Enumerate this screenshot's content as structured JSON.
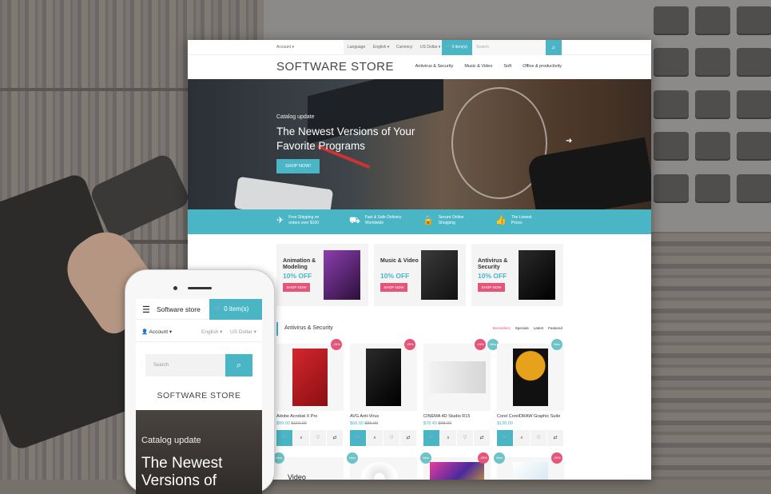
{
  "desktop": {
    "topbar": {
      "account": "Account ▾",
      "language": "Language",
      "language_value": "English ▾",
      "currency": "Currency",
      "currency_value": "US Dollar ▾",
      "cart": "0 item(s)",
      "search_placeholder": "Search"
    },
    "logo": "SOFTWARE STORE",
    "nav": [
      "Antivirus & Security",
      "Music & Video",
      "Soft",
      "Office & productivity"
    ],
    "hero": {
      "kicker": "Catalog update",
      "headline": "The Newest Versions of Your Favorite Programs",
      "button": "SHOP NOW!"
    },
    "features": [
      {
        "icon": "paper-plane-icon",
        "text": "Free Shipping on orders over $100"
      },
      {
        "icon": "truck-icon",
        "text": "Fast & Safe Delivery Worldwide"
      },
      {
        "icon": "lock-icon",
        "text": "Secure Online Shopping"
      },
      {
        "icon": "thumbs-up-icon",
        "text": "The Lowest Prices"
      }
    ],
    "banners": [
      {
        "title": "Animation & Modeling",
        "offer": "10% OFF",
        "button": "SHOP NOW",
        "box_color": "#6a2a8a"
      },
      {
        "title": "Music & Video",
        "offer": "10% OFF",
        "button": "SHOP NOW",
        "box_color": "#2a2a2a"
      },
      {
        "title": "Antivirus & Security",
        "offer": "10% OFF",
        "button": "SHOP NOW",
        "box_color": "#1a1a1a"
      }
    ],
    "section": {
      "title": "Antivirus & Security",
      "tabs": [
        "Bestsellers",
        "Specials",
        "Latest",
        "Featured"
      ]
    },
    "products": [
      {
        "name": "Adobe Acrobat X Pro",
        "price": "$99.90",
        "old_price": "$110.00",
        "badge": "-20%",
        "badge_type": "pink",
        "box_color": "#c0272d"
      },
      {
        "name": "AVG Anti-Virus",
        "price": "$68.00",
        "old_price": "$85.00",
        "badge": "-20%",
        "badge_type": "pink",
        "box_color": "#1a1a1a"
      },
      {
        "name": "CINEMA 4D Studio R15",
        "price": "$78.40",
        "old_price": "$98.00",
        "badge": "-15%",
        "badge_type": "pink",
        "badge2": "New",
        "box_color": "#e8e8e8"
      },
      {
        "name": "Corel CorelDRAW Graphic Suite",
        "price": "$130.00",
        "old_price": "",
        "badge": "New",
        "badge_type": "teal",
        "box_color": "#111"
      }
    ],
    "products_row2": [
      {
        "badge": "New",
        "badge_type": "teal",
        "label": "Video"
      },
      {
        "badge": "New",
        "badge_type": "teal",
        "label": ""
      },
      {
        "badge": "-25%",
        "badge_type": "pink",
        "badge2": "New",
        "label": ""
      },
      {
        "badge": "-20%",
        "badge_type": "pink",
        "badge2": "New",
        "label": ""
      }
    ]
  },
  "mobile": {
    "title": "Software store",
    "cart": "0 item(s)",
    "account": "Account ▾",
    "language": "English ▾",
    "currency": "US Dollar ▾",
    "search_placeholder": "Search",
    "logo": "SOFTWARE STORE",
    "kicker": "Catalog update",
    "headline": "The Newest Versions of"
  },
  "colors": {
    "accent": "#4ab6c5",
    "sale": "#e4557a"
  }
}
